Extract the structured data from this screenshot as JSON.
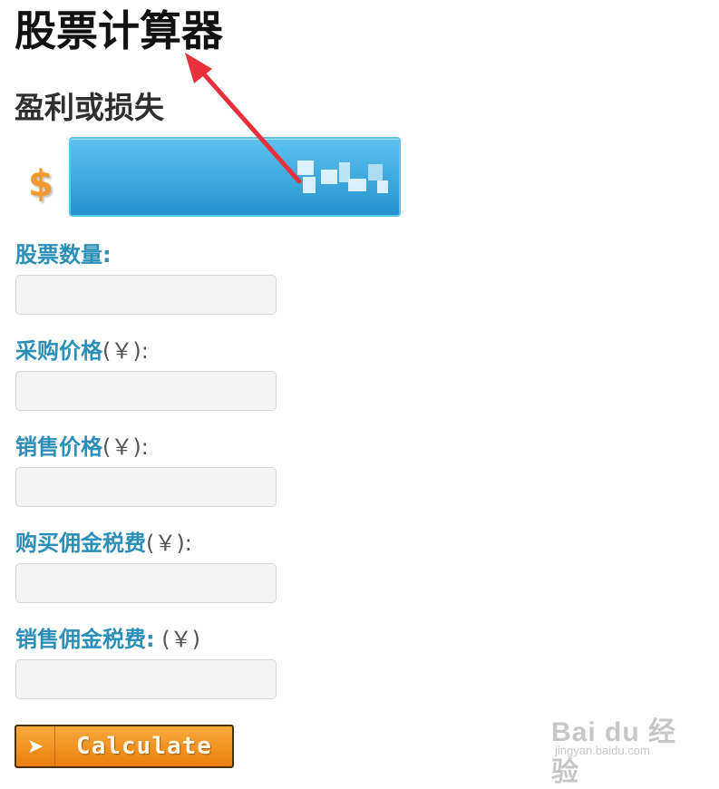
{
  "page": {
    "title": "股票计算器",
    "subtitle": "盈利或损失"
  },
  "result": {
    "currency_symbol": "$",
    "value_blurred": true
  },
  "fields": [
    {
      "label": "股票数量:",
      "unit": "",
      "value": "",
      "placeholder": ""
    },
    {
      "label": "采购价格",
      "unit": "(￥):",
      "value": "",
      "placeholder": ""
    },
    {
      "label": "销售价格",
      "unit": "(￥):",
      "value": "",
      "placeholder": ""
    },
    {
      "label": "购买佣金税费",
      "unit": "(￥):",
      "value": "",
      "placeholder": ""
    },
    {
      "label": "销售佣金税费:",
      "unit": " (￥)",
      "value": "",
      "placeholder": ""
    }
  ],
  "button": {
    "label": "Calculate",
    "icon": "play-arrow-icon"
  },
  "watermark": {
    "main": "Bai du 经验",
    "sub": "jingyan.baidu.com"
  },
  "colors": {
    "label_blue": "#2b8fb8",
    "result_blue": "#2493cd",
    "button_orange": "#ea7f0c",
    "dollar_orange": "#f19a30",
    "annotation_red": "#e8303a"
  }
}
